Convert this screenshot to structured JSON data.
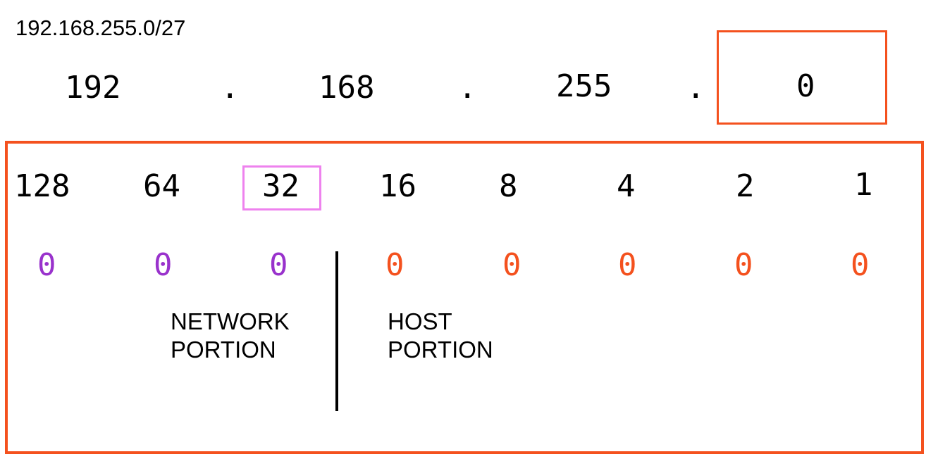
{
  "cidr_label": "192.168.255.0/27",
  "octets": [
    "192",
    "168",
    "255",
    "0"
  ],
  "dot": ".",
  "bit_values": [
    "128",
    "64",
    "32",
    "16",
    "8",
    "4",
    "2",
    "1"
  ],
  "bits": [
    "0",
    "0",
    "0",
    "0",
    "0",
    "0",
    "0",
    "0"
  ],
  "network_label": [
    "NETWORK",
    "PORTION"
  ],
  "host_label": [
    "HOST",
    "PORTION"
  ],
  "colors": {
    "highlight_border": "#f4511e",
    "network_bits": "#9932cc",
    "host_bits": "#f4511e",
    "bit_highlight": "#ee82ee"
  }
}
